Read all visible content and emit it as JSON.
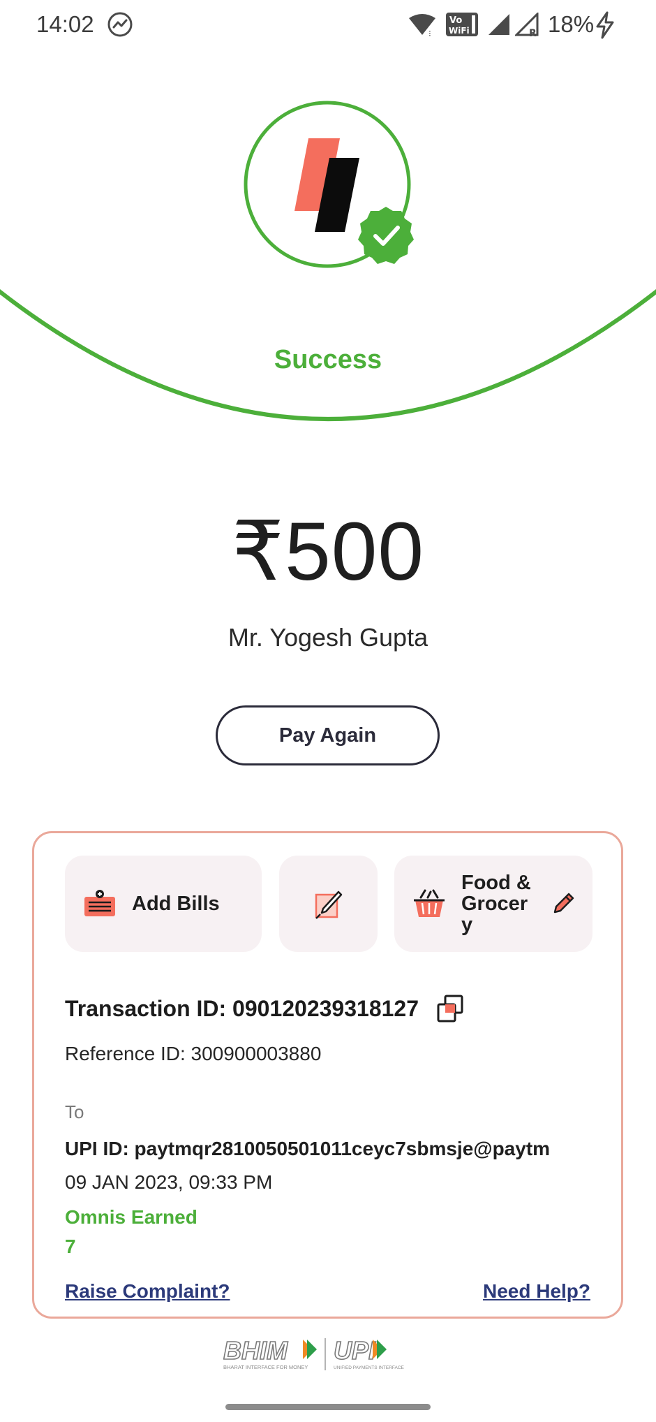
{
  "status_bar": {
    "time": "14:02",
    "battery": "18%",
    "icons": [
      "messenger-icon",
      "wifi-icon",
      "vowifi-icon",
      "signal-icon",
      "roaming-signal-icon",
      "charging-icon"
    ]
  },
  "hero": {
    "status": "Success",
    "accent_color": "#4caf3a",
    "logo_icon": "payment-app-logo-icon",
    "badge_icon": "verified-check-icon"
  },
  "payment": {
    "amount": "₹500",
    "payee": "Mr. Yogesh Gupta",
    "pay_again_label": "Pay Again"
  },
  "card": {
    "chips": [
      {
        "label": "Add Bills",
        "icon": "bill-icon"
      },
      {
        "label": "",
        "icon": "note-edit-icon"
      },
      {
        "label": "Food & Grocer y",
        "icon": "basket-icon",
        "edit_icon": "pencil-icon"
      }
    ],
    "transaction_id": "Transaction ID: 090120239318127",
    "reference_id": "Reference ID: 300900003880",
    "to_label": "To",
    "upi_id": "UPI ID: paytmqr2810050501011ceyc7sbmsje@paytm",
    "datetime": "09 JAN 2023, 09:33 PM",
    "omnis_label": "Omnis Earned",
    "omnis_value": "7",
    "raise_complaint": "Raise Complaint?",
    "need_help": "Need Help?"
  },
  "footer": {
    "logo_icon": "bhim-upi-logo-icon",
    "bhim_text": "BHIM",
    "upi_text": "UPI",
    "bhim_tagline": "BHARAT INTERFACE FOR MONEY",
    "upi_tagline": "UNIFIED PAYMENTS INTERFACE"
  }
}
